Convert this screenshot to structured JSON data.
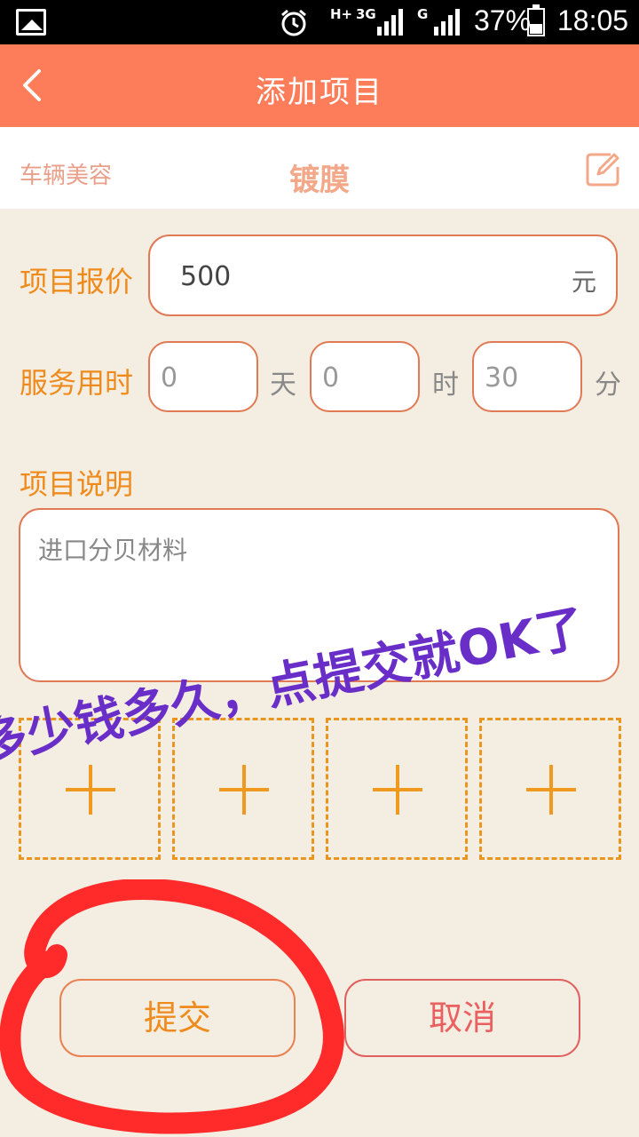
{
  "status_bar": {
    "network_a": "H+",
    "network_b": "3G",
    "network_c": "G",
    "battery": "37%",
    "time": "18:05",
    "icons": [
      "gallery-icon",
      "alarm-icon",
      "signal-icon",
      "signal-icon",
      "battery-icon"
    ]
  },
  "header": {
    "title": "添加项目",
    "back_icon": "chevron-left-icon"
  },
  "category": {
    "group": "车辆美容",
    "name": "镀膜",
    "edit_icon": "edit-icon"
  },
  "form": {
    "price_label": "项目报价",
    "price_value": "500",
    "price_unit": "元",
    "duration_label": "服务用时",
    "days_value": "0",
    "days_unit": "天",
    "hours_value": "0",
    "hours_unit": "时",
    "minutes_value": "30",
    "minutes_unit": "分",
    "description_label": "项目说明",
    "description_value": "进口分贝材料"
  },
  "photos": [
    {
      "icon": "plus-icon"
    },
    {
      "icon": "plus-icon"
    },
    {
      "icon": "plus-icon"
    },
    {
      "icon": "plus-icon"
    }
  ],
  "actions": {
    "submit": "提交",
    "cancel": "取消"
  },
  "annotation": {
    "text": "多少钱多久，点提交就OK了",
    "text_color": "#6a2ec8",
    "circle_color": "#ff2a2a"
  },
  "colors": {
    "header": "#fd7c59",
    "accent": "#ee8b1c",
    "background": "#f4ede1"
  }
}
